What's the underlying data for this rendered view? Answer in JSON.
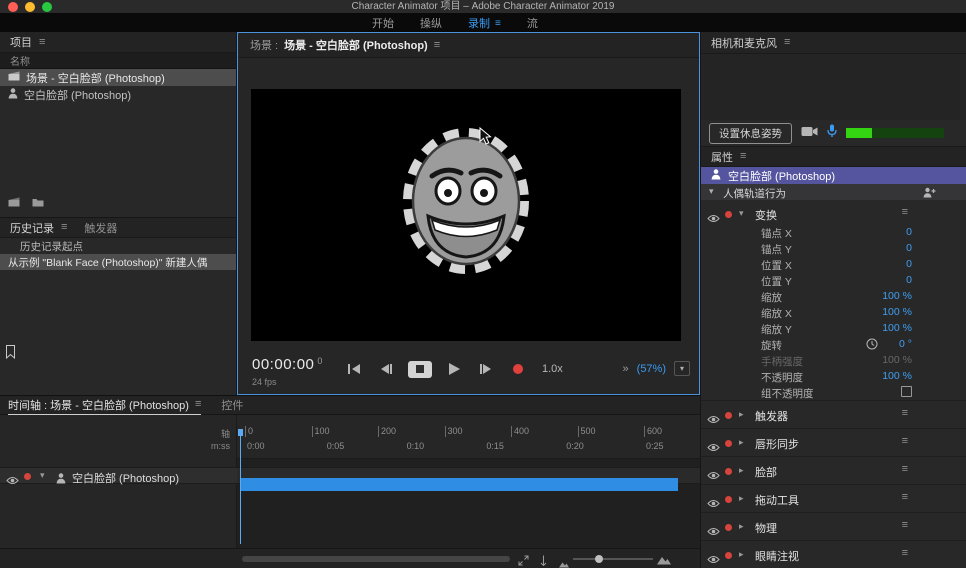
{
  "titlebar": {
    "title": "Character Animator 项目 – Adobe Character Animator 2019"
  },
  "icons": {
    "menu": "≡",
    "chevron_down": "▾",
    "chevron_right": "▸",
    "double_chevron": "»"
  },
  "workspace_tabs": [
    {
      "label": "开始"
    },
    {
      "label": "操纵"
    },
    {
      "label": "录制",
      "active": true
    },
    {
      "label": "流"
    }
  ],
  "project": {
    "title": "项目",
    "name_column": "名称",
    "items": [
      {
        "label": "场景 - 空白脸部 (Photoshop)",
        "selected": true
      },
      {
        "label": "空白脸部 (Photoshop)",
        "selected": false
      }
    ]
  },
  "history": {
    "tab_history": "历史记录",
    "tab_triggers": "触发器",
    "items": [
      {
        "label": "历史记录起点",
        "selected": false
      },
      {
        "label": "从示例 \"Blank Face (Photoshop)\" 新建人偶",
        "selected": true
      }
    ]
  },
  "scene": {
    "label_prefix": "场景 :",
    "title": "场景 - 空白脸部 (Photoshop)",
    "timecode": "00:00:00",
    "frame_suffix": "0",
    "fps": "24 fps",
    "speed": "1.0x",
    "zoom": "(57%)"
  },
  "camera_mic": {
    "title": "相机和麦克风",
    "rest_pose_button": "设置休息姿势"
  },
  "properties": {
    "title": "属性",
    "puppet_name": "空白脸部 (Photoshop)",
    "group_label": "人偶轨道行为",
    "transform": {
      "label": "变换",
      "params": [
        {
          "label": "锚点 X",
          "value": "0"
        },
        {
          "label": "锚点 Y",
          "value": "0"
        },
        {
          "label": "位置 X",
          "value": "0"
        },
        {
          "label": "位置 Y",
          "value": "0"
        },
        {
          "label": "缩放",
          "value": "100 %"
        },
        {
          "label": "缩放 X",
          "value": "100 %"
        },
        {
          "label": "缩放 Y",
          "value": "100 %"
        },
        {
          "label": "旋转",
          "value": "0 °",
          "icon": "clock"
        },
        {
          "label": "手柄强度",
          "value": "100 %",
          "disabled": true
        },
        {
          "label": "不透明度",
          "value": "100 %"
        },
        {
          "label": "组不透明度",
          "checkbox": true
        }
      ]
    },
    "behaviors": [
      {
        "label": "触发器"
      },
      {
        "label": "唇形同步"
      },
      {
        "label": "脸部"
      },
      {
        "label": "拖动工具"
      },
      {
        "label": "物理"
      },
      {
        "label": "眼睛注视"
      }
    ]
  },
  "timeline": {
    "tab_main": "时间轴 : 场景 - 空白脸部 (Photoshop)",
    "tab_controls": "控件",
    "axis_label": "轴",
    "time_axis_label": "m:ss",
    "frame_ticks": [
      "0",
      "100",
      "200",
      "300",
      "400",
      "500",
      "600"
    ],
    "time_ticks": [
      "0:00",
      "0:05",
      "0:10",
      "0:15",
      "0:20",
      "0:25"
    ],
    "track": {
      "label": "空白脸部 (Photoshop)"
    }
  },
  "colors": {
    "accent_blue": "#3a9bf4",
    "timeline_bar": "#2f8de4",
    "selection_purple": "#55549f",
    "record_red": "#e0413c",
    "meter_green": "#35d413"
  }
}
